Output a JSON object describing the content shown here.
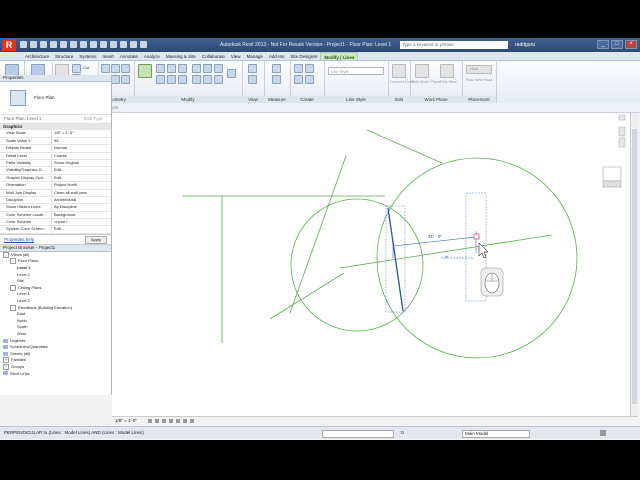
{
  "titlebar": {
    "logo": "R",
    "title": "Autodesk Revit 2013 - Not For Resale Version - Project1 - Floor Plan: Level 1",
    "search_placeholder": "Type a keyword or phrase",
    "user": "raddguru",
    "buttons": [
      "_",
      "□",
      "×"
    ]
  },
  "tabs": [
    "Architecture",
    "Structure",
    "Systems",
    "Insert",
    "Annotate",
    "Analyze",
    "Massing & Site",
    "Collaborate",
    "View",
    "Manage",
    "Add-Ins",
    "Site Designer",
    "Modify | Lines"
  ],
  "active_tab": "Modify | Lines",
  "ribbon": {
    "select": {
      "modify_label": "Modify",
      "panel": "Select ▾"
    },
    "properties": {
      "label": "Properties",
      "panel": "Properties"
    },
    "clipboard": {
      "paste": "Paste",
      "cut": "Cut",
      "copy": "Copy",
      "join": "Join",
      "panel": "Clipboard"
    },
    "geometry_panel": "Geometry",
    "modify_panel": "Modify",
    "view_panel": "View",
    "measure_panel": "Measure",
    "create_panel": "Create",
    "line_style": {
      "value": "Line Style",
      "panel": "Line Style"
    },
    "edit": {
      "label": "Convert Lines",
      "panel": "Edit"
    },
    "work_plane": {
      "edit": "Edit Work Plane",
      "pick": "Pick New",
      "panel": "Work Plane"
    },
    "placement": {
      "host": "Host",
      "pick": "Pick New Host",
      "panel": "Placement"
    }
  },
  "optionsbar": {
    "context": "Modify | Lines",
    "constrain": "Constrain",
    "disjoin": "Disjoin",
    "multiple": "Multiple"
  },
  "properties": {
    "header": "Properties",
    "type_name": "Floor Plan",
    "instance": "Floor Plan: Level 1",
    "edit_type": "Edit Type",
    "section": "Graphics",
    "rows": [
      {
        "k": "View Scale",
        "v": "1/8\" = 1'-0\""
      },
      {
        "k": "Scale Value 1:",
        "v": "96"
      },
      {
        "k": "Display Model",
        "v": "Normal"
      },
      {
        "k": "Detail Level",
        "v": "Coarse"
      },
      {
        "k": "Parts Visibility",
        "v": "Show Original"
      },
      {
        "k": "Visibility/Graphics O...",
        "v": "Edit..."
      },
      {
        "k": "Graphic Display Opti...",
        "v": "Edit..."
      },
      {
        "k": "Orientation",
        "v": "Project North"
      },
      {
        "k": "Wall Join Display",
        "v": "Clean all wall joins"
      },
      {
        "k": "Discipline",
        "v": "Architectural"
      },
      {
        "k": "Show Hidden Lines",
        "v": "By Discipline"
      },
      {
        "k": "Color Scheme Locati...",
        "v": "Background"
      },
      {
        "k": "Color Scheme",
        "v": "<none>"
      },
      {
        "k": "System Color Schem...",
        "v": "Edit..."
      }
    ],
    "help": "Properties help",
    "apply": "Apply"
  },
  "browser": {
    "header": "Project Browser - Project1",
    "nodes": [
      {
        "t": "Views (all)",
        "lvl": 0,
        "exp": "-",
        "bold": false
      },
      {
        "t": "Floor Plans",
        "lvl": 1,
        "exp": "-",
        "bold": false
      },
      {
        "t": "Level 1",
        "lvl": 2,
        "exp": "",
        "bold": true
      },
      {
        "t": "Level 2",
        "lvl": 2,
        "exp": "",
        "bold": false
      },
      {
        "t": "Site",
        "lvl": 2,
        "exp": "",
        "bold": false
      },
      {
        "t": "Ceiling Plans",
        "lvl": 1,
        "exp": "-",
        "bold": false
      },
      {
        "t": "Level 1",
        "lvl": 2,
        "exp": "",
        "bold": false
      },
      {
        "t": "Level 2",
        "lvl": 2,
        "exp": "",
        "bold": false
      },
      {
        "t": "Elevations (Building Elevation)",
        "lvl": 1,
        "exp": "-",
        "bold": false
      },
      {
        "t": "East",
        "lvl": 2,
        "exp": "",
        "bold": false
      },
      {
        "t": "North",
        "lvl": 2,
        "exp": "",
        "bold": false
      },
      {
        "t": "South",
        "lvl": 2,
        "exp": "",
        "bold": false
      },
      {
        "t": "West",
        "lvl": 2,
        "exp": "",
        "bold": false
      },
      {
        "t": "Legends",
        "lvl": 0,
        "exp": "",
        "bold": false
      },
      {
        "t": "Schedules/Quantities",
        "lvl": 0,
        "exp": "",
        "bold": false
      },
      {
        "t": "Sheets (all)",
        "lvl": 0,
        "exp": "",
        "bold": false
      },
      {
        "t": "Families",
        "lvl": 0,
        "exp": "+",
        "bold": false
      },
      {
        "t": "Groups",
        "lvl": 0,
        "exp": "+",
        "bold": false
      },
      {
        "t": "Revit Links",
        "lvl": 0,
        "exp": "",
        "bold": false
      }
    ]
  },
  "canvas": {
    "dimension": "31' - 0\"",
    "temp_dim": "8'",
    "line_color": "#5cae52",
    "select_color": "#2a4fa8"
  },
  "viewbar": {
    "scale": "1/8\" = 1'-0\""
  },
  "statusbar": {
    "text": "PERPENDICULAR  to (Lines : Model Lines) AND (Lines : Model Lines)",
    "model": "Main Model",
    "zero": ":0"
  }
}
